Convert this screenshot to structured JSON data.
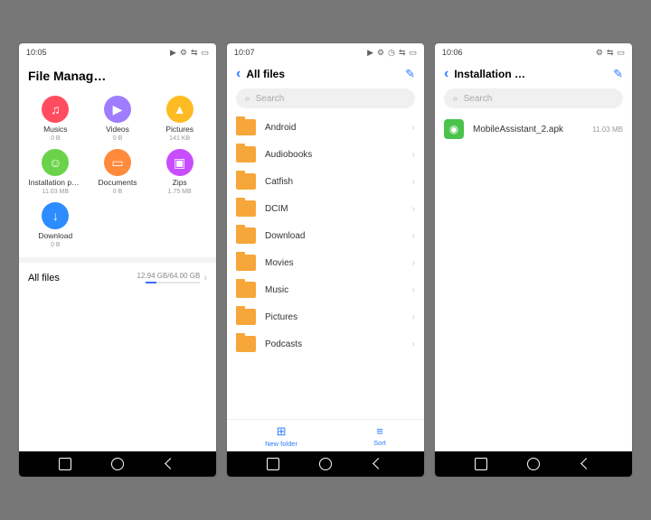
{
  "s1": {
    "status_time": "10:05",
    "title": "File Manag…",
    "categories": [
      {
        "label": "Musics",
        "size": "0 B",
        "color": "#ff4d5f",
        "glyph": "♫"
      },
      {
        "label": "Videos",
        "size": "0 B",
        "color": "#a07dff",
        "glyph": "▶"
      },
      {
        "label": "Pictures",
        "size": "141 KB",
        "color": "#ffbb24",
        "glyph": "▲"
      },
      {
        "label": "Installation pack…",
        "size": "11.03 MB",
        "color": "#6bd34a",
        "glyph": "☺"
      },
      {
        "label": "Documents",
        "size": "0 B",
        "color": "#ff8a3c",
        "glyph": "▭"
      },
      {
        "label": "Zips",
        "size": "1.75 MB",
        "color": "#c84dff",
        "glyph": "▣"
      },
      {
        "label": "Download",
        "size": "0 B",
        "color": "#2d8cff",
        "glyph": "↓"
      }
    ],
    "all_files_label": "All files",
    "storage_text": "12.94 GB/64.00 GB"
  },
  "s2": {
    "status_time": "10:07",
    "header": "All files",
    "search_placeholder": "Search",
    "folders": [
      "Android",
      "Audiobooks",
      "Catfish",
      "DCIM",
      "Download",
      "Movies",
      "Music",
      "Pictures",
      "Podcasts"
    ],
    "bottom": {
      "new_folder": "New folder",
      "sort": "Sort"
    }
  },
  "s3": {
    "status_time": "10:06",
    "header": "Installation …",
    "search_placeholder": "Search",
    "file": {
      "name": "MobileAssistant_2.apk",
      "size": "11.03 MB"
    }
  }
}
